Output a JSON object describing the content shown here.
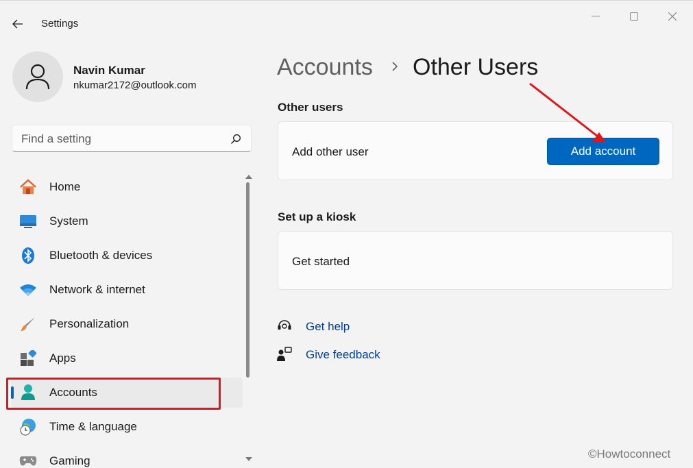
{
  "window": {
    "title": "Settings",
    "controls": [
      "minimize",
      "maximize",
      "close"
    ]
  },
  "profile": {
    "name": "Navin Kumar",
    "email": "nkumar2172@outlook.com"
  },
  "search": {
    "placeholder": "Find a setting"
  },
  "sidebar": {
    "items": [
      {
        "label": "Home",
        "icon": "home-icon"
      },
      {
        "label": "System",
        "icon": "system-icon"
      },
      {
        "label": "Bluetooth & devices",
        "icon": "bluetooth-icon"
      },
      {
        "label": "Network & internet",
        "icon": "wifi-icon"
      },
      {
        "label": "Personalization",
        "icon": "brush-icon"
      },
      {
        "label": "Apps",
        "icon": "apps-icon"
      },
      {
        "label": "Accounts",
        "icon": "accounts-icon",
        "selected": true
      },
      {
        "label": "Time & language",
        "icon": "globe-clock-icon"
      },
      {
        "label": "Gaming",
        "icon": "gamepad-icon"
      }
    ]
  },
  "breadcrumb": {
    "parent": "Accounts",
    "current": "Other Users"
  },
  "sections": {
    "other_users": {
      "title": "Other users",
      "row_label": "Add other user",
      "button_label": "Add account"
    },
    "kiosk": {
      "title": "Set up a kiosk",
      "row_label": "Get started"
    }
  },
  "help": {
    "get_help": "Get help",
    "give_feedback": "Give feedback"
  },
  "watermark": "©Howtoconnect",
  "colors": {
    "accent": "#0067c0",
    "link": "#003e92",
    "annotation": "#e0161a",
    "background": "#f3f3f3"
  }
}
